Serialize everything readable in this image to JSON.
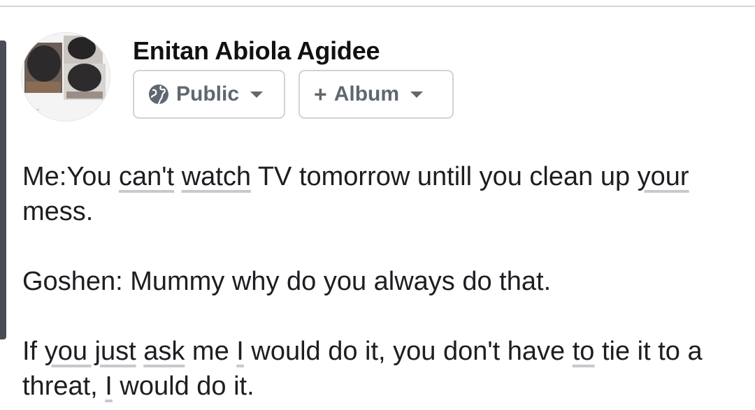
{
  "post_header": {
    "author_name": "Enitan Abiola Agidee",
    "privacy_button": {
      "label": "Public",
      "icon": "globe-icon"
    },
    "album_button": {
      "label": "Album",
      "icon": "plus-icon"
    }
  },
  "post_body": {
    "paragraphs": [
      [
        {
          "text": "Me:You "
        },
        {
          "text": "can't",
          "underlined": true
        },
        {
          "text": " "
        },
        {
          "text": "watch",
          "underlined": true
        },
        {
          "text": " TV tomorrow untill you clean up "
        },
        {
          "text": "your",
          "underlined": true
        },
        {
          "text": " mess."
        }
      ],
      [
        {
          "text": "Goshen: Mummy why do you always do that."
        }
      ],
      [
        {
          "text": "If "
        },
        {
          "text": "you just",
          "underlined": true
        },
        {
          "text": " "
        },
        {
          "text": "ask",
          "underlined": true
        },
        {
          "text": " me "
        },
        {
          "text": "I",
          "underlined": true
        },
        {
          "text": " would do it, you don't have "
        },
        {
          "text": "to",
          "underlined": true
        },
        {
          "text": " tie it to a threat, "
        },
        {
          "text": "I",
          "underlined": true
        },
        {
          "text": " would do it."
        }
      ]
    ]
  },
  "colors": {
    "chip_text": "#606770",
    "chip_border": "#cfd3d8",
    "spellcheck_underline": "#c7c9cc",
    "side_bar": "#4a4c55"
  }
}
